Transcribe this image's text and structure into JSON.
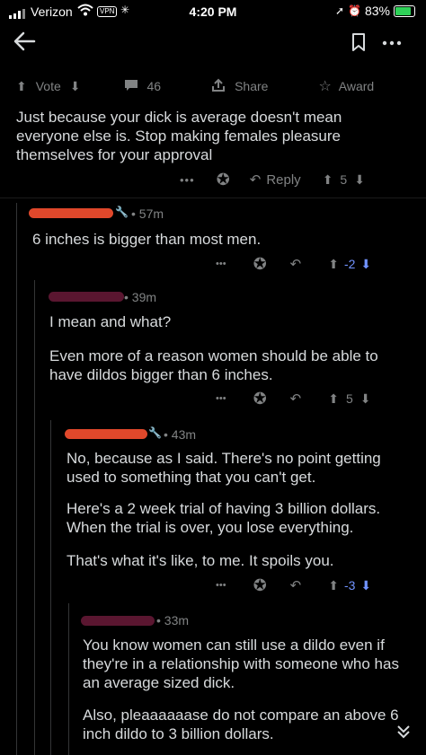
{
  "status": {
    "carrier": "Verizon",
    "vpn": "VPN",
    "time": "4:20 PM",
    "battery": "83%"
  },
  "post_actions": {
    "vote": "Vote",
    "comments": "46",
    "share": "Share",
    "award": "Award"
  },
  "comment0": {
    "text": "Just because your dick is average doesn't mean everyone else is. Stop making females pleasure themselves for your approval",
    "reply_label": "Reply",
    "score": "5"
  },
  "comment1": {
    "age": "57m",
    "text": "6 inches is bigger than most men.",
    "score": "-2"
  },
  "comment2": {
    "age": "39m",
    "line1": "I mean and what?",
    "line2": "Even more of a reason women should be able to have dildos bigger than 6 inches.",
    "score": "5"
  },
  "comment3": {
    "age": "43m",
    "p1": "No, because as I said. There's no point getting used to something that you can't get.",
    "p2": "Here's a 2 week trial of having 3 billion dollars. When the trial is over, you lose everything.",
    "p3": "That's what it's like, to me. It spoils you.",
    "score": "-3"
  },
  "comment4": {
    "age": "33m",
    "p1": "You know women can still use a dildo even if they're in a relationship with someone who has an average sized dick.",
    "p2": "Also, pleaaaaaase do not compare an above 6 inch dildo to 3 billion dollars."
  },
  "colors": {
    "background": "#000000",
    "text": "#d7dadc",
    "muted": "#818384",
    "downvote": "#7193ff",
    "thread": "#343536"
  }
}
